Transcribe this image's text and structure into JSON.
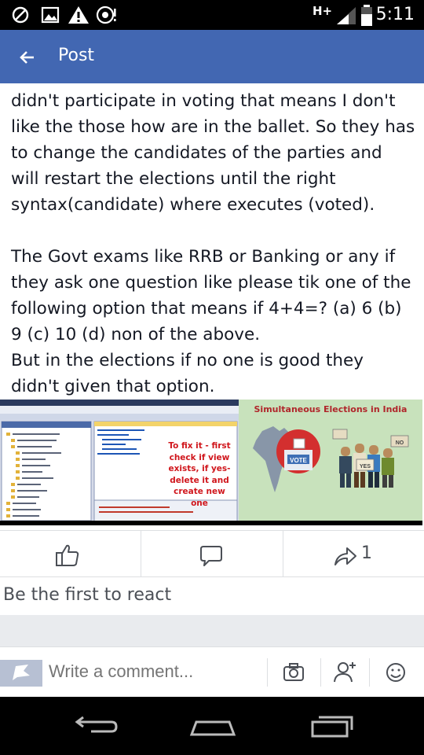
{
  "status_bar": {
    "time": "5:11",
    "network": "H+",
    "icons": [
      "sync-off-icon",
      "image-icon",
      "warning-icon",
      "no-signal-chat-icon",
      "signal-icon",
      "battery-icon"
    ]
  },
  "app_bar": {
    "title": "Post",
    "back_icon": "back-arrow-icon",
    "color": "#4267b2"
  },
  "post": {
    "paragraphs": [
      [
        "didn't participate in voting that means I don't",
        "like the those how are in the ballet. So they has",
        "to change the candidates of the parties and",
        "will restart the elections until the right",
        "syntax(candidate) where executes (voted)."
      ],
      [
        "The Govt exams like RRB or Banking or any if",
        "they ask one question like please tik one of the",
        "following option that means if 4+4=?  (a) 6 (b)",
        "9 (c) 10 (d) non of the above.",
        "But in the elections if no one is good they",
        "didn't given that option."
      ]
    ]
  },
  "images": {
    "left": {
      "note_lines": [
        "To fix it - first",
        "check if view",
        "exists, if yes-",
        "delete it and",
        "create new",
        "one"
      ]
    },
    "right": {
      "title": "Simultaneous Elections in India",
      "ballot_label": "VOTE",
      "sign_label": "NO",
      "sign_label_2": "YES"
    }
  },
  "actions": {
    "like_icon": "thumbs-up-icon",
    "comment_icon": "comment-bubble-icon",
    "share_icon": "share-arrow-icon",
    "share_count": "1"
  },
  "reactions_text": "Be the first to react",
  "comment_bar": {
    "placeholder": "Write a comment...",
    "buttons": [
      "camera-icon",
      "mention-person-icon",
      "emoji-icon"
    ]
  },
  "nav_bar": {
    "buttons": [
      "back-nav-icon",
      "home-nav-icon",
      "recent-apps-icon"
    ]
  }
}
